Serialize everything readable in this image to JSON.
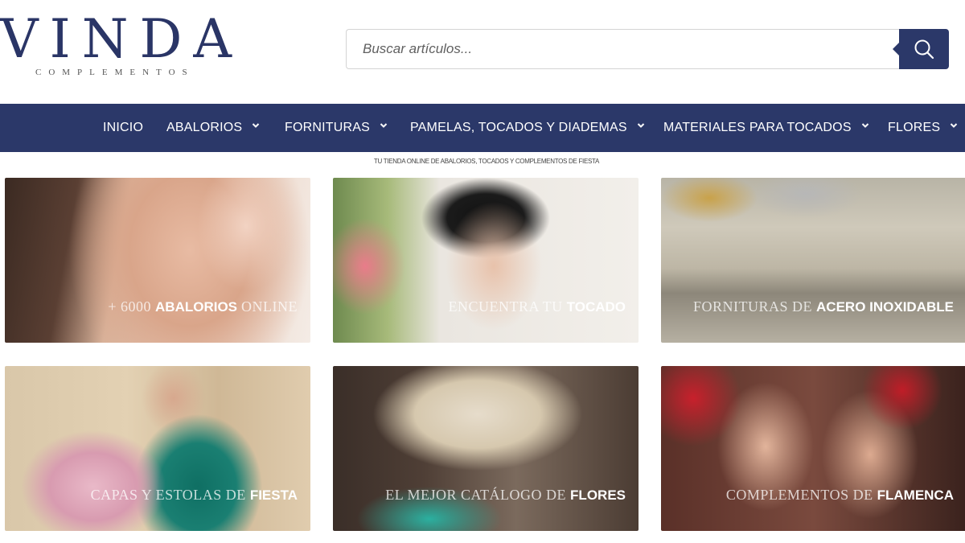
{
  "logo": {
    "main": "VINDA",
    "sub": "COMPLEMENTOS"
  },
  "search": {
    "placeholder": "Buscar artículos...",
    "button_icon": "search-icon"
  },
  "nav": {
    "items": [
      {
        "label": "INICIO",
        "has_dropdown": false
      },
      {
        "label": "ABALORIOS",
        "has_dropdown": true
      },
      {
        "label": "FORNITURAS",
        "has_dropdown": true
      },
      {
        "label": "PAMELAS, TOCADOS Y DIADEMAS",
        "has_dropdown": true
      },
      {
        "label": "MATERIALES PARA TOCADOS",
        "has_dropdown": true
      },
      {
        "label": "FLORES",
        "has_dropdown": true
      }
    ]
  },
  "tagline": "TU TIENDA ONLINE DE ABALORIOS, TOCADOS Y COMPLEMENTOS DE FIESTA",
  "tiles": [
    {
      "light": "+ 6000",
      "bold": "ABALORIOS",
      "tail": "ONLINE"
    },
    {
      "light": "ENCUENTRA TU",
      "bold": "TOCADO",
      "tail": ""
    },
    {
      "light": "FORNITURAS DE",
      "bold": "ACERO INOXIDABLE",
      "tail": ""
    },
    {
      "light": "CAPAS Y ESTOLAS DE",
      "bold": "FIESTA",
      "tail": ""
    },
    {
      "light": "EL MEJOR CATÁLOGO DE",
      "bold": "FLORES",
      "tail": ""
    },
    {
      "light": "COMPLEMENTOS DE",
      "bold": "FLAMENCA",
      "tail": ""
    }
  ],
  "colors": {
    "brand": "#2b3869",
    "logo": "#2a3566"
  }
}
